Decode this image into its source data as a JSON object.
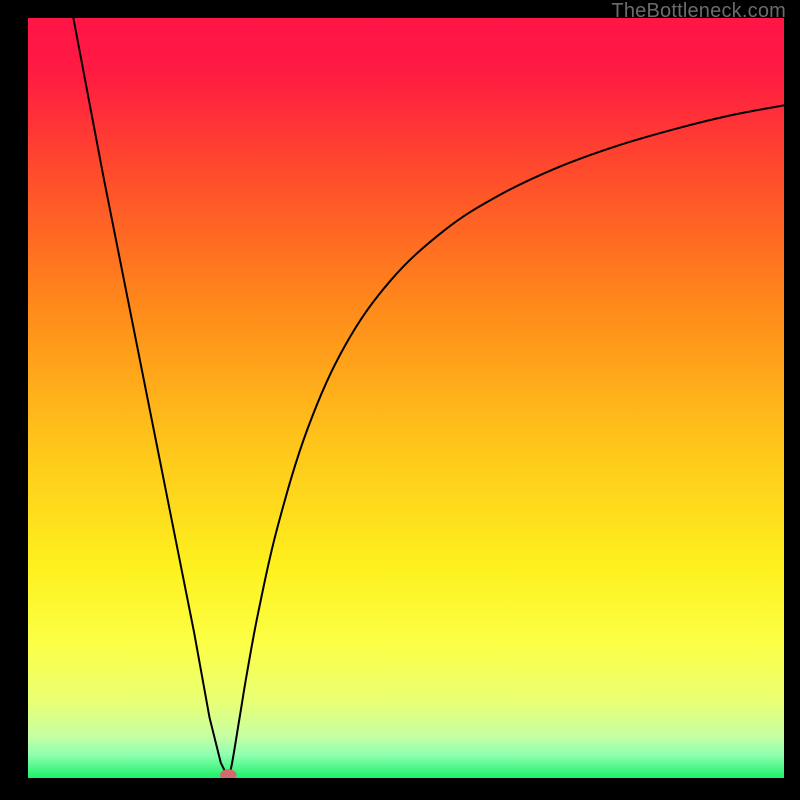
{
  "watermark": "TheBottleneck.com",
  "chart_data": {
    "type": "line",
    "xlabel": "",
    "ylabel": "",
    "xlim": [
      0,
      100
    ],
    "ylim": [
      0,
      100
    ],
    "grid": false,
    "background_gradient": {
      "stops": [
        {
          "offset": 0.0,
          "color": "#ff1547"
        },
        {
          "offset": 0.07,
          "color": "#ff1a42"
        },
        {
          "offset": 0.2,
          "color": "#ff4a2c"
        },
        {
          "offset": 0.38,
          "color": "#ff8a1a"
        },
        {
          "offset": 0.55,
          "color": "#ffc21a"
        },
        {
          "offset": 0.72,
          "color": "#fef01e"
        },
        {
          "offset": 0.82,
          "color": "#fcff44"
        },
        {
          "offset": 0.9,
          "color": "#e9ff74"
        },
        {
          "offset": 0.945,
          "color": "#c6ffa4"
        },
        {
          "offset": 0.97,
          "color": "#8effb0"
        },
        {
          "offset": 1.0,
          "color": "#1cf06a"
        }
      ]
    },
    "series": [
      {
        "name": "left-branch",
        "x": [
          6,
          10,
          14,
          18,
          22,
          24,
          25.5,
          26.5
        ],
        "y": [
          100,
          79,
          59,
          39,
          19,
          8,
          2,
          0
        ]
      },
      {
        "name": "right-branch",
        "x": [
          26.5,
          27,
          28,
          29,
          30.5,
          33,
          37,
          42,
          48,
          55,
          62,
          70,
          78,
          86,
          93,
          100
        ],
        "y": [
          0,
          2,
          8,
          14,
          22,
          33,
          46,
          57,
          65.5,
          72,
          76.5,
          80.3,
          83.2,
          85.5,
          87.2,
          88.5
        ]
      }
    ],
    "marker": {
      "x": 26.5,
      "y": 0,
      "color": "#d26b6f"
    }
  }
}
